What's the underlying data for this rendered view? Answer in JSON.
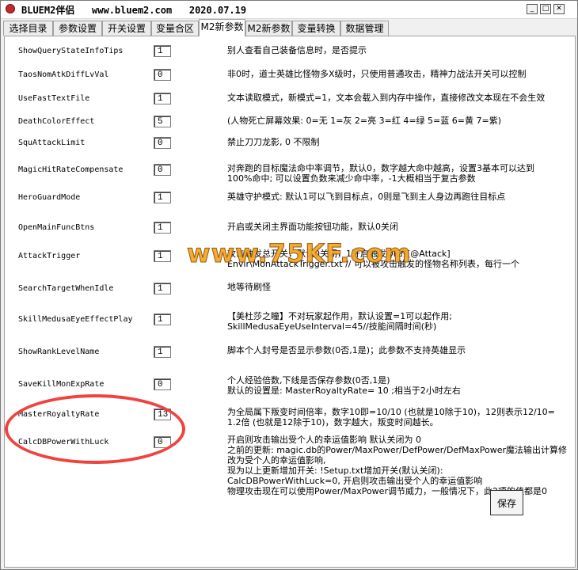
{
  "window": {
    "title": "BLUEM2伴侣   www.bluem2.com   2020.07.19",
    "minimize": "_",
    "maximize": "□",
    "close": "✕"
  },
  "tabs": [
    {
      "label": "选择目录",
      "active": false
    },
    {
      "label": "参数设置",
      "active": false
    },
    {
      "label": "开关设置",
      "active": false
    },
    {
      "label": "变量合区",
      "active": false
    },
    {
      "label": "M2新参数",
      "active": true
    },
    {
      "label": "M2新参数",
      "active": false
    },
    {
      "label": "变量转换",
      "active": false
    },
    {
      "label": "数据管理",
      "active": false
    }
  ],
  "params": [
    {
      "name": "ShowQueryStateInfoTips",
      "value": "1",
      "desc": [
        "别人查看自己装备信息时，是否提示"
      ]
    },
    {
      "name": "TaosNomAtkDiffLvVal",
      "value": "0",
      "desc": [
        "非0时，道士英雄比怪物多X级时，只使用普通攻击，精神力战法开关可以控制"
      ]
    },
    {
      "name": "UseFastTextFile",
      "value": "1",
      "desc": [
        "文本读取模式，新模式=1，文本会载入到内存中操作，直接修改文本现在不会生效"
      ]
    },
    {
      "name": "DeathColorEffect",
      "value": "5",
      "desc": [
        "(人物死亡屏幕效果: 0=无 1=灰 2=亮 3=红 4=绿 5=蓝 6=黄 7=紫)"
      ]
    },
    {
      "name": "SquAttackLimit",
      "value": "0",
      "desc": [
        "禁止刀刀龙影, 0 不限制"
      ]
    },
    {
      "name": "MagicHitRateCompensate",
      "value": "0",
      "desc": [
        "对奔跑的目标魔法命中率调节，默认0，数字越大命中越高，设置3基本可以达到",
        "100%命中; 可以设置负数来减少命中率，-1大概相当于复古参数"
      ]
    },
    {
      "name": "HeroGuardMode",
      "value": "1",
      "desc": [
        "英雄守护模式: 默认1可以飞到目标点，0则是飞到主人身边再跑往目标点"
      ]
    },
    {
      "name": "OpenMainFuncBtns",
      "value": "1",
      "desc": [
        "开启或关闭主界面功能按钮功能，默认0关闭"
      ]
    },
    {
      "name": "AttackTrigger",
      "value": "1",
      "desc": [
        "攻击触发总开关，默认0关闭，1开启触发QF的[@Attack]",
        "Envir\\MonAttackTrigger.txt // 可以被攻击触发的怪物名称列表，每行一个"
      ]
    },
    {
      "name": "SearchTargetWhenIdle",
      "value": "1",
      "desc": [
        "                             地等待刷怪"
      ]
    },
    {
      "name": "SkillMedusaEyeEffectPlay",
      "value": "1",
      "desc": [
        "【美杜莎之瞳】不对玩家起作用，默认设置=1可以起作用;",
        "SkillMedusaEyeUseInterval=45//技能间隔时间(秒)"
      ]
    },
    {
      "name": "ShowRankLevelName",
      "value": "1",
      "desc": [
        "脚本个人封号是否显示参数(0否,1是)；此参数不支持英雄显示"
      ]
    },
    {
      "name": "SaveKillMonExpRate",
      "value": "0",
      "desc": [
        "个人经验倍数,下线是否保存参数(0否,1是)",
        "默认的设置是: MasterRoyaltyRate= 10 ;相当于2小时左右"
      ]
    },
    {
      "name": "MasterRoyaltyRate",
      "value": "13",
      "desc": [
        "为全局属下叛变时间倍率，数字10即=10/10 (也就是10除于10)，12则表示12/10=",
        "1.2倍 (也就是12除于10)，数字越大，叛变时间越长。"
      ]
    },
    {
      "name": "CalcDBPowerWithLuck",
      "value": "0",
      "desc": [
        "开启则攻击输出受个人的幸运值影响 默认关闭为 0",
        "之前的更新: magic.db的Power/MaxPower/DefPower/DefMaxPower魔法输出计算修",
        "改为受个人的幸运值影响,",
        "现为以上更新增加开关: !Setup.txt增加开关(默认关闭):",
        "CalcDBPowerWithLuck=0, 开启则攻击输出受个人的幸运值影响",
        "物理攻击现在可以使用Power/MaxPower调节威力，一般情况下，此2项的值都是0"
      ]
    }
  ],
  "save_label": "保存",
  "watermark": "www.75KF.com"
}
